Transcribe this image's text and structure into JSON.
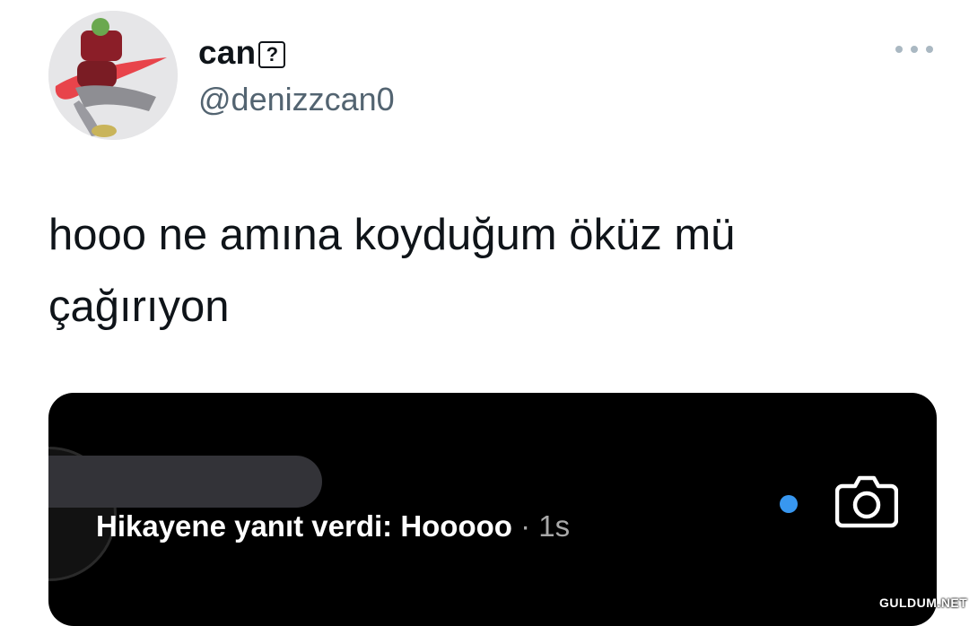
{
  "author": {
    "display_name": "can",
    "name_glyph": "?",
    "handle": "@denizzcan0"
  },
  "tweet": {
    "text": "hooo ne amına koyduğum öküz mü çağırıyon"
  },
  "story_reply": {
    "message": "Hikayene yanıt verdi: Hooooo",
    "separator": " · ",
    "time": "1s"
  },
  "watermark": "GULDUM.NET",
  "icons": {
    "more": "more-horizontal-icon",
    "camera": "camera-icon",
    "unread": "unread-dot"
  },
  "colors": {
    "unread_dot": "#3897f0",
    "card_bg": "#000000",
    "handle": "#536471"
  }
}
